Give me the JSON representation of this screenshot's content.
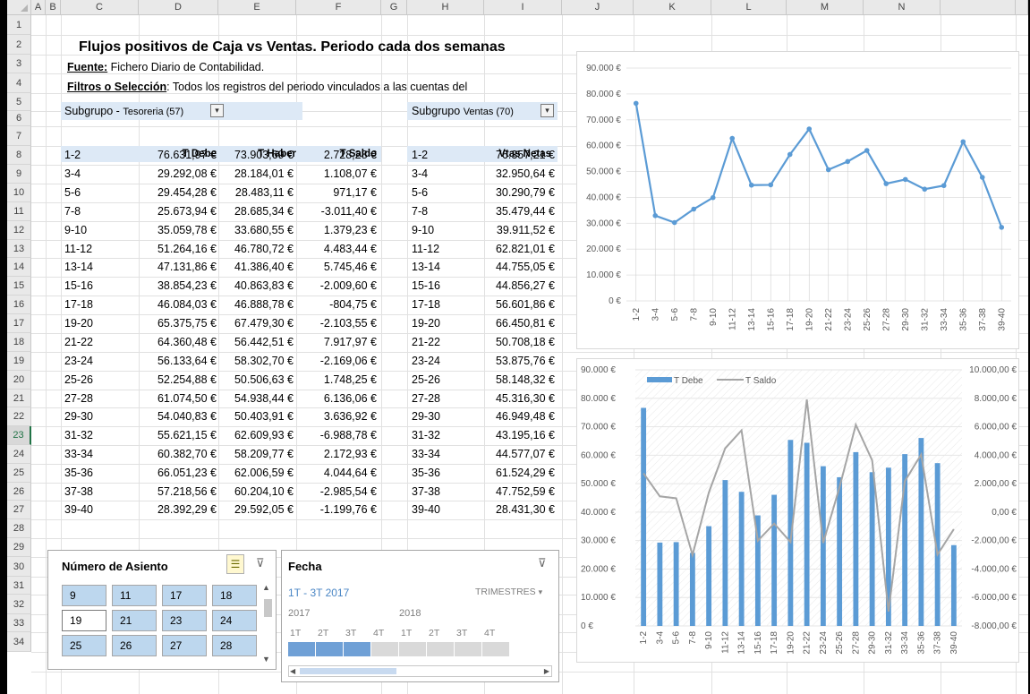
{
  "columns": [
    "A",
    "B",
    "C",
    "D",
    "E",
    "F",
    "G",
    "H",
    "I",
    "J",
    "K",
    "L",
    "M",
    "N"
  ],
  "rows": [
    "1",
    "2",
    "3",
    "4",
    "5",
    "6",
    "7",
    "8",
    "9",
    "10",
    "11",
    "12",
    "13",
    "14",
    "15",
    "16",
    "17",
    "18",
    "19",
    "20",
    "21",
    "22",
    "23",
    "24",
    "25",
    "26",
    "27",
    "28",
    "29",
    "30",
    "31",
    "32",
    "33",
    "34"
  ],
  "sheet": {
    "title": "Flujos positivos de Caja vs Ventas. Periodo cada dos semanas",
    "source_label": "Fuente:",
    "source_value": " Fichero Diario de Contabilidad.",
    "filters_label": "Filtros o Selección",
    "filters_value": ": Todos los registros del periodo vinculados a las cuentas del",
    "subgroup1_label": "Subgrupo -",
    "subgroup1_value": "Tesoreria (57)",
    "subgroup2_label": "Subgrupo",
    "subgroup2_value": "Ventas (70)"
  },
  "table1": {
    "headers": [
      "T Debe",
      "T Haber",
      "T Saldo"
    ],
    "rows": [
      {
        "p": "1-2",
        "d": "76.631,97 €",
        "h": "73.903,69 €",
        "s": "2.728,28 €"
      },
      {
        "p": "3-4",
        "d": "29.292,08 €",
        "h": "28.184,01 €",
        "s": "1.108,07 €"
      },
      {
        "p": "5-6",
        "d": "29.454,28 €",
        "h": "28.483,11 €",
        "s": "971,17 €"
      },
      {
        "p": "7-8",
        "d": "25.673,94 €",
        "h": "28.685,34 €",
        "s": "-3.011,40 €"
      },
      {
        "p": "9-10",
        "d": "35.059,78 €",
        "h": "33.680,55 €",
        "s": "1.379,23 €"
      },
      {
        "p": "11-12",
        "d": "51.264,16 €",
        "h": "46.780,72 €",
        "s": "4.483,44 €"
      },
      {
        "p": "13-14",
        "d": "47.131,86 €",
        "h": "41.386,40 €",
        "s": "5.745,46 €"
      },
      {
        "p": "15-16",
        "d": "38.854,23 €",
        "h": "40.863,83 €",
        "s": "-2.009,60 €"
      },
      {
        "p": "17-18",
        "d": "46.084,03 €",
        "h": "46.888,78 €",
        "s": "-804,75 €"
      },
      {
        "p": "19-20",
        "d": "65.375,75 €",
        "h": "67.479,30 €",
        "s": "-2.103,55 €"
      },
      {
        "p": "21-22",
        "d": "64.360,48 €",
        "h": "56.442,51 €",
        "s": "7.917,97 €"
      },
      {
        "p": "23-24",
        "d": "56.133,64 €",
        "h": "58.302,70 €",
        "s": "-2.169,06 €"
      },
      {
        "p": "25-26",
        "d": "52.254,88 €",
        "h": "50.506,63 €",
        "s": "1.748,25 €"
      },
      {
        "p": "27-28",
        "d": "61.074,50 €",
        "h": "54.938,44 €",
        "s": "6.136,06 €"
      },
      {
        "p": "29-30",
        "d": "54.040,83 €",
        "h": "50.403,91 €",
        "s": "3.636,92 €"
      },
      {
        "p": "31-32",
        "d": "55.621,15 €",
        "h": "62.609,93 €",
        "s": "-6.988,78 €"
      },
      {
        "p": "33-34",
        "d": "60.382,70 €",
        "h": "58.209,77 €",
        "s": "2.172,93 €"
      },
      {
        "p": "35-36",
        "d": "66.051,23 €",
        "h": "62.006,59 €",
        "s": "4.044,64 €"
      },
      {
        "p": "37-38",
        "d": "57.218,56 €",
        "h": "60.204,10 €",
        "s": "-2.985,54 €"
      },
      {
        "p": "39-40",
        "d": "28.392,29 €",
        "h": "29.592,05 €",
        "s": "-1.199,76 €"
      }
    ]
  },
  "table2": {
    "header": "Vtas  Netas",
    "rows": [
      {
        "p": "1-2",
        "v": "76.357,21 €"
      },
      {
        "p": "3-4",
        "v": "32.950,64 €"
      },
      {
        "p": "5-6",
        "v": "30.290,79 €"
      },
      {
        "p": "7-8",
        "v": "35.479,44 €"
      },
      {
        "p": "9-10",
        "v": "39.911,52 €"
      },
      {
        "p": "11-12",
        "v": "62.821,01 €"
      },
      {
        "p": "13-14",
        "v": "44.755,05 €"
      },
      {
        "p": "15-16",
        "v": "44.856,27 €"
      },
      {
        "p": "17-18",
        "v": "56.601,86 €"
      },
      {
        "p": "19-20",
        "v": "66.450,81 €"
      },
      {
        "p": "21-22",
        "v": "50.708,18 €"
      },
      {
        "p": "23-24",
        "v": "53.875,76 €"
      },
      {
        "p": "25-26",
        "v": "58.148,32 €"
      },
      {
        "p": "27-28",
        "v": "45.316,30 €"
      },
      {
        "p": "29-30",
        "v": "46.949,48 €"
      },
      {
        "p": "31-32",
        "v": "43.195,16 €"
      },
      {
        "p": "33-34",
        "v": "44.577,07 €"
      },
      {
        "p": "35-36",
        "v": "61.524,29 €"
      },
      {
        "p": "37-38",
        "v": "47.752,59 €"
      },
      {
        "p": "39-40",
        "v": "28.431,30 €"
      }
    ]
  },
  "slicer_asiento": {
    "title": "Número de Asiento",
    "buttons": [
      {
        "label": "9",
        "selected": true
      },
      {
        "label": "11",
        "selected": true
      },
      {
        "label": "17",
        "selected": true
      },
      {
        "label": "18",
        "selected": true
      },
      {
        "label": "19",
        "selected": false
      },
      {
        "label": "21",
        "selected": true
      },
      {
        "label": "23",
        "selected": true
      },
      {
        "label": "24",
        "selected": true
      },
      {
        "label": "25",
        "selected": true
      },
      {
        "label": "26",
        "selected": true
      },
      {
        "label": "27",
        "selected": true
      },
      {
        "label": "28",
        "selected": true
      }
    ]
  },
  "slicer_fecha": {
    "title": "Fecha",
    "range": "1T - 3T 2017",
    "level": "TRIMESTRES",
    "years": [
      "2017",
      "2018"
    ],
    "quarters": [
      "1T",
      "2T",
      "3T",
      "4T",
      "1T",
      "2T",
      "3T",
      "4T"
    ],
    "selected_quarters": [
      true,
      true,
      true,
      false,
      false,
      false,
      false,
      false
    ]
  },
  "chart_data": [
    {
      "type": "line",
      "title": "",
      "categories": [
        "1-2",
        "3-4",
        "5-6",
        "7-8",
        "9-10",
        "11-12",
        "13-14",
        "15-16",
        "17-18",
        "19-20",
        "21-22",
        "23-24",
        "25-26",
        "27-28",
        "29-30",
        "31-32",
        "33-34",
        "35-36",
        "37-38",
        "39-40"
      ],
      "series": [
        {
          "values": [
            76357.21,
            32950.64,
            30290.79,
            35479.44,
            39911.52,
            62821.01,
            44755.05,
            44856.27,
            56601.86,
            66450.81,
            50708.18,
            53875.76,
            58148.32,
            45316.3,
            46949.48,
            43195.16,
            44577.07,
            61524.29,
            47752.59,
            28431.3
          ],
          "color": "#5b9bd5"
        }
      ],
      "ylim": [
        0,
        90000
      ],
      "yticks": [
        "0 €",
        "10.000 €",
        "20.000 €",
        "30.000 €",
        "40.000 €",
        "50.000 €",
        "60.000 €",
        "70.000 €",
        "80.000 €",
        "90.000 €"
      ],
      "grid": true
    },
    {
      "type": "bar",
      "title": "",
      "categories": [
        "1-2",
        "3-4",
        "5-6",
        "7-8",
        "9-10",
        "11-12",
        "13-14",
        "15-16",
        "17-18",
        "19-20",
        "21-22",
        "23-24",
        "25-26",
        "27-28",
        "29-30",
        "31-32",
        "33-34",
        "35-36",
        "37-38",
        "39-40"
      ],
      "series": [
        {
          "name": "T Debe",
          "type": "bar",
          "axis": "left",
          "color": "#5b9bd5",
          "values": [
            76631.97,
            29292.08,
            29454.28,
            25673.94,
            35059.78,
            51264.16,
            47131.86,
            38854.23,
            46084.03,
            65375.75,
            64360.48,
            56133.64,
            52254.88,
            61074.5,
            54040.83,
            55621.15,
            60382.7,
            66051.23,
            57218.56,
            28392.29
          ]
        },
        {
          "name": "T Saldo",
          "type": "line",
          "axis": "right",
          "color": "#a5a5a5",
          "values": [
            2728.28,
            1108.07,
            971.17,
            -3011.4,
            1379.23,
            4483.44,
            5745.46,
            -2009.6,
            -804.75,
            -2103.55,
            7917.97,
            -2169.06,
            1748.25,
            6136.06,
            3636.92,
            -6988.78,
            2172.93,
            4044.64,
            -2985.54,
            -1199.76
          ]
        }
      ],
      "ylim": [
        0,
        90000
      ],
      "y2lim": [
        -8000,
        10000
      ],
      "yticks": [
        "0 €",
        "10.000 €",
        "20.000 €",
        "30.000 €",
        "40.000 €",
        "50.000 €",
        "60.000 €",
        "70.000 €",
        "80.000 €",
        "90.000 €"
      ],
      "y2ticks": [
        "-8.000,00 €",
        "-6.000,00 €",
        "-4.000,00 €",
        "-2.000,00 €",
        "0,00 €",
        "2.000,00 €",
        "4.000,00 €",
        "6.000,00 €",
        "8.000,00 €",
        "10.000,00 €"
      ],
      "legend": "top-left",
      "grid": true
    }
  ]
}
